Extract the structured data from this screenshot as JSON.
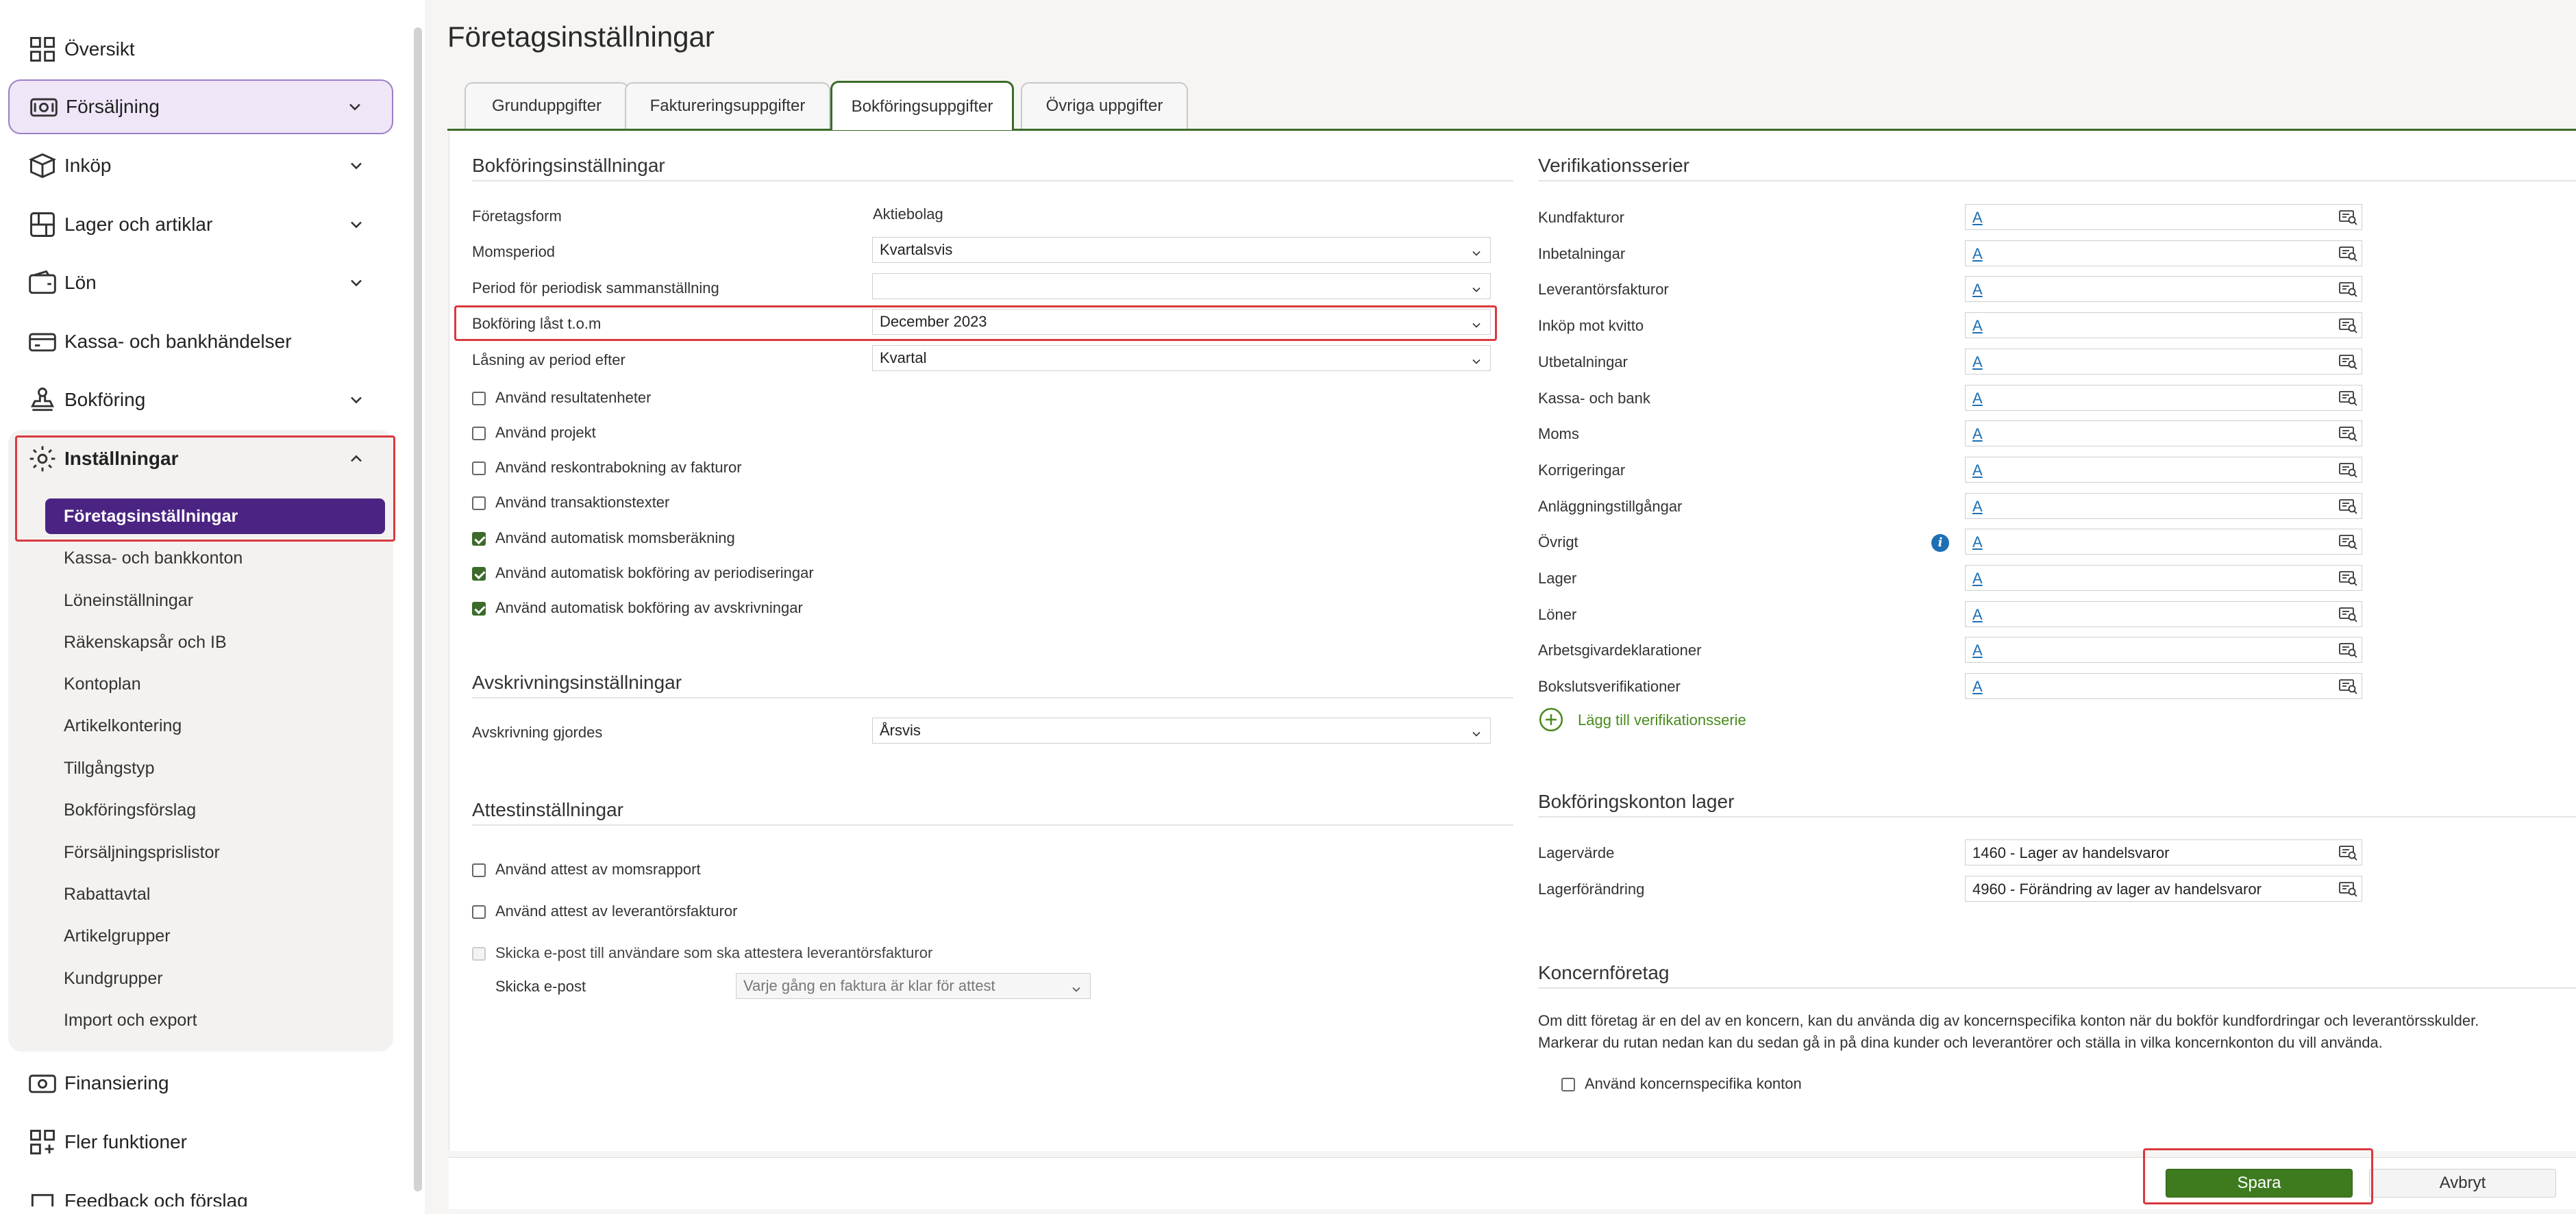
{
  "sidebar": {
    "items": [
      {
        "label": "Översikt",
        "icon": "grid-icon"
      },
      {
        "label": "Försäljning",
        "icon": "cash-register-icon"
      },
      {
        "label": "Inköp",
        "icon": "box-icon"
      },
      {
        "label": "Lager och artiklar",
        "icon": "shelf-icon"
      },
      {
        "label": "Lön",
        "icon": "wallet-icon"
      },
      {
        "label": "Kassa- och bankhändelser",
        "icon": "bank-icon"
      },
      {
        "label": "Bokföring",
        "icon": "stamp-icon"
      },
      {
        "label": "Inställningar",
        "icon": "gear-icon"
      }
    ],
    "settings_sub": [
      "Företagsinställningar",
      "Kassa- och bankkonton",
      "Löneinställningar",
      "Räkenskapsår och IB",
      "Kontoplan",
      "Artikelkontering",
      "Tillgångstyp",
      "Bokföringsförslag",
      "Försäljningsprislistor",
      "Rabattavtal",
      "Artikelgrupper",
      "Kundgrupper",
      "Import och export"
    ],
    "bottom_items": [
      {
        "label": "Finansiering",
        "icon": "money-icon"
      },
      {
        "label": "Fler funktioner",
        "icon": "grid-plus-icon"
      },
      {
        "label": "Feedback och förslag",
        "icon": "feedback-icon"
      }
    ]
  },
  "page": {
    "title": "Företagsinställningar",
    "tabs": [
      "Grunduppgifter",
      "Faktureringsuppgifter",
      "Bokföringsuppgifter",
      "Övriga uppgifter"
    ],
    "active_tab": "Bokföringsuppgifter"
  },
  "bokforing": {
    "title": "Bokföringsinställningar",
    "foretagsform_label": "Företagsform",
    "foretagsform_value": "Aktiebolag",
    "momsperiod_label": "Momsperiod",
    "momsperiod_value": "Kvartalsvis",
    "period_label": "Period för periodisk sammanställning",
    "period_value": "",
    "last_label": "Bokföring låst t.o.m",
    "last_value": "December 2023",
    "lasning_label": "Låsning av period efter",
    "lasning_value": "Kvartal",
    "checkboxes": [
      {
        "label": "Använd resultatenheter",
        "checked": false
      },
      {
        "label": "Använd projekt",
        "checked": false
      },
      {
        "label": "Använd reskontrabokning av fakturor",
        "checked": false
      },
      {
        "label": "Använd transaktionstexter",
        "checked": false
      },
      {
        "label": "Använd automatisk momsberäkning",
        "checked": true
      },
      {
        "label": "Använd automatisk bokföring av periodiseringar",
        "checked": true
      },
      {
        "label": "Använd automatisk bokföring av avskrivningar",
        "checked": true
      }
    ]
  },
  "avskrivning": {
    "title": "Avskrivningsinställningar",
    "label": "Avskrivning gjordes",
    "value": "Årsvis"
  },
  "attest": {
    "title": "Attestinställningar",
    "cb1": "Använd attest av momsrapport",
    "cb2": "Använd attest av leverantörsfakturor",
    "cb3": "Skicka e-post till användare som ska attestera leverantörsfakturor",
    "epost_label": "Skicka e-post",
    "epost_value": "Varje gång en faktura är klar för attest"
  },
  "serier": {
    "title": "Verifikationsserier",
    "rows": [
      {
        "label": "Kundfakturor",
        "value": "A"
      },
      {
        "label": "Inbetalningar",
        "value": "A"
      },
      {
        "label": "Leverantörsfakturor",
        "value": "A"
      },
      {
        "label": "Inköp mot kvitto",
        "value": "A"
      },
      {
        "label": "Utbetalningar",
        "value": "A"
      },
      {
        "label": "Kassa- och bank",
        "value": "A"
      },
      {
        "label": "Moms",
        "value": "A"
      },
      {
        "label": "Korrigeringar",
        "value": "A"
      },
      {
        "label": "Anläggningstillgångar",
        "value": "A"
      },
      {
        "label": "Övrigt",
        "value": "A"
      },
      {
        "label": "Lager",
        "value": "A"
      },
      {
        "label": "Löner",
        "value": "A"
      },
      {
        "label": "Arbetsgivardeklarationer",
        "value": "A"
      },
      {
        "label": "Bokslutsverifikationer",
        "value": "A"
      }
    ],
    "add_label": "Lägg till verifikationsserie"
  },
  "lager": {
    "title": "Bokföringskonton lager",
    "rows": [
      {
        "label": "Lagervärde",
        "value": "1460 - Lager av handelsvaror"
      },
      {
        "label": "Lagerförändring",
        "value": "4960 - Förändring av lager av handelsvaror"
      }
    ]
  },
  "koncern": {
    "title": "Koncernföretag",
    "text1": "Om ditt företag är en del av en koncern, kan du använda dig av koncernspecifika konton när du bokför kundfordringar och leverantörsskulder.",
    "text2": "Markerar du rutan nedan kan du sedan gå in på dina kunder och leverantörer och ställa in vilka koncernkonton du vill använda.",
    "cb": "Använd koncernspecifika konton"
  },
  "footer": {
    "save": "Spara",
    "cancel": "Avbryt"
  },
  "colors": {
    "accent_green": "#3e7a1e",
    "active_purple": "#4b2483",
    "highlight_red": "#d9393f",
    "link_blue": "#1d6fb3"
  }
}
